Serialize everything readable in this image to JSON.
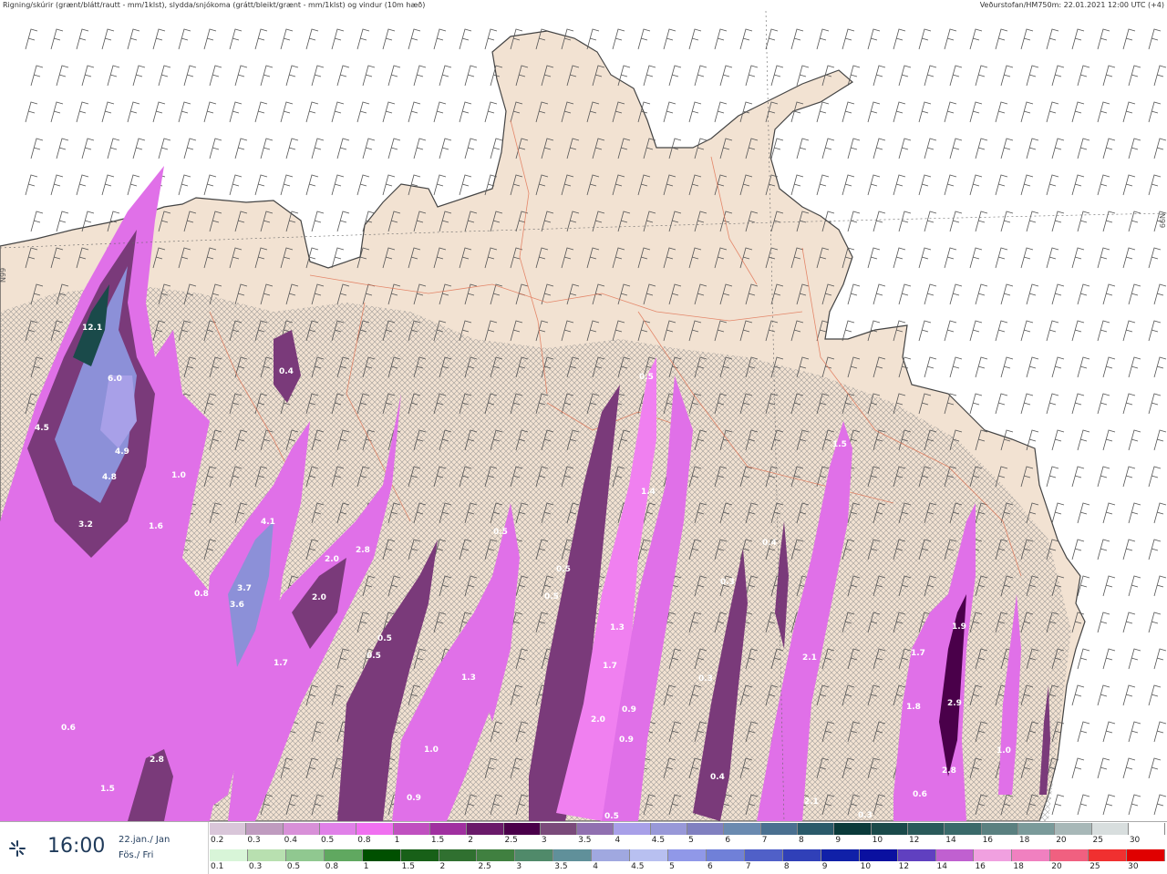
{
  "header": {
    "left_text": "Rigning/skúrir (grænt/blátt/rautt - mm/1klst), slydda/snjókoma (grátt/bleikt/grænt - mm/1klst) og vindur (10m hæð)",
    "right_text": "Veðurstofan/HM750m: 22.01.2021 12:00 UTC (+4)"
  },
  "footer": {
    "time": "16:00",
    "date_line1": "22.jan./ Jan",
    "date_line2": "Fös./ Fri",
    "icon": "wind-icon"
  },
  "grid_labels": [
    "N99",
    "N99"
  ],
  "precip_labels": [
    {
      "text": "12.1"
    },
    {
      "text": "6.0"
    },
    {
      "text": "4.5"
    },
    {
      "text": "4.9"
    },
    {
      "text": "4.8"
    },
    {
      "text": "3.2"
    },
    {
      "text": "1.0"
    },
    {
      "text": "1.6"
    },
    {
      "text": "0.4"
    },
    {
      "text": "4.1"
    },
    {
      "text": "3.7"
    },
    {
      "text": "3.6"
    },
    {
      "text": "0.8"
    },
    {
      "text": "2.0"
    },
    {
      "text": "2.8"
    },
    {
      "text": "2.0"
    },
    {
      "text": "1.7"
    },
    {
      "text": "0.5"
    },
    {
      "text": "0.5"
    },
    {
      "text": "1.3"
    },
    {
      "text": "1.0"
    },
    {
      "text": "0.9"
    },
    {
      "text": "0.6"
    },
    {
      "text": "1.5"
    },
    {
      "text": "2.8"
    },
    {
      "text": "0.5"
    },
    {
      "text": "0.5"
    },
    {
      "text": "1.4"
    },
    {
      "text": "0.5"
    },
    {
      "text": "0.5"
    },
    {
      "text": "1.3"
    },
    {
      "text": "1.7"
    },
    {
      "text": "2.0"
    },
    {
      "text": "0.9"
    },
    {
      "text": "0.9"
    },
    {
      "text": "0.5"
    },
    {
      "text": "0.3"
    },
    {
      "text": "0.4"
    },
    {
      "text": "0.3"
    },
    {
      "text": "0.4"
    },
    {
      "text": "1.5"
    },
    {
      "text": "2.1"
    },
    {
      "text": "2.1"
    },
    {
      "text": "0.3"
    },
    {
      "text": "1.9"
    },
    {
      "text": "1.7"
    },
    {
      "text": "1.8"
    },
    {
      "text": "2.9"
    },
    {
      "text": "2.8"
    },
    {
      "text": "0.6"
    },
    {
      "text": "1.0"
    }
  ],
  "legend_snow": {
    "labels": [
      "0.2",
      "0.3",
      "0.4",
      "0.5",
      "0.8",
      "1",
      "1.5",
      "2",
      "2.5",
      "3",
      "3.5",
      "4",
      "4.5",
      "5",
      "6",
      "7",
      "8",
      "9",
      "10",
      "12",
      "14",
      "16",
      "18",
      "20",
      "25",
      "30"
    ],
    "colors": [
      "#d9c6d9",
      "#bf9bbf",
      "#d890d8",
      "#e080e8",
      "#f070f0",
      "#c050c0",
      "#a030a0",
      "#6a1a6a",
      "#4a004a",
      "#7a4a7a",
      "#9070b0",
      "#a8a0e8",
      "#9898d8",
      "#8080c0",
      "#6a8ab0",
      "#4a7090",
      "#2a5a6a",
      "#0a3a3a",
      "#1a4a4a",
      "#2a5a5a",
      "#3a6a6a",
      "#5a8080",
      "#7a9a9a",
      "#a8b8b8",
      "#d8dede",
      "#ffffff"
    ]
  },
  "legend_rain": {
    "labels": [
      "0.1",
      "0.3",
      "0.5",
      "0.8",
      "1",
      "1.5",
      "2",
      "2.5",
      "3",
      "3.5",
      "4",
      "4.5",
      "5",
      "6",
      "7",
      "8",
      "9",
      "10",
      "12",
      "14",
      "16",
      "18",
      "20",
      "25",
      "30"
    ],
    "colors": [
      "#d8f5d8",
      "#b8e0b0",
      "#90c890",
      "#60a860",
      "#005000",
      "#186018",
      "#307030",
      "#408040",
      "#508a6a",
      "#60909a",
      "#a0a8e0",
      "#b8c0f0",
      "#9098e8",
      "#7080d8",
      "#5060c8",
      "#3040b8",
      "#1020a8",
      "#0a10a0",
      "#6040c0",
      "#c060d0",
      "#f0a0e0",
      "#f080c0",
      "#f06080",
      "#f03030",
      "#e00000"
    ]
  }
}
